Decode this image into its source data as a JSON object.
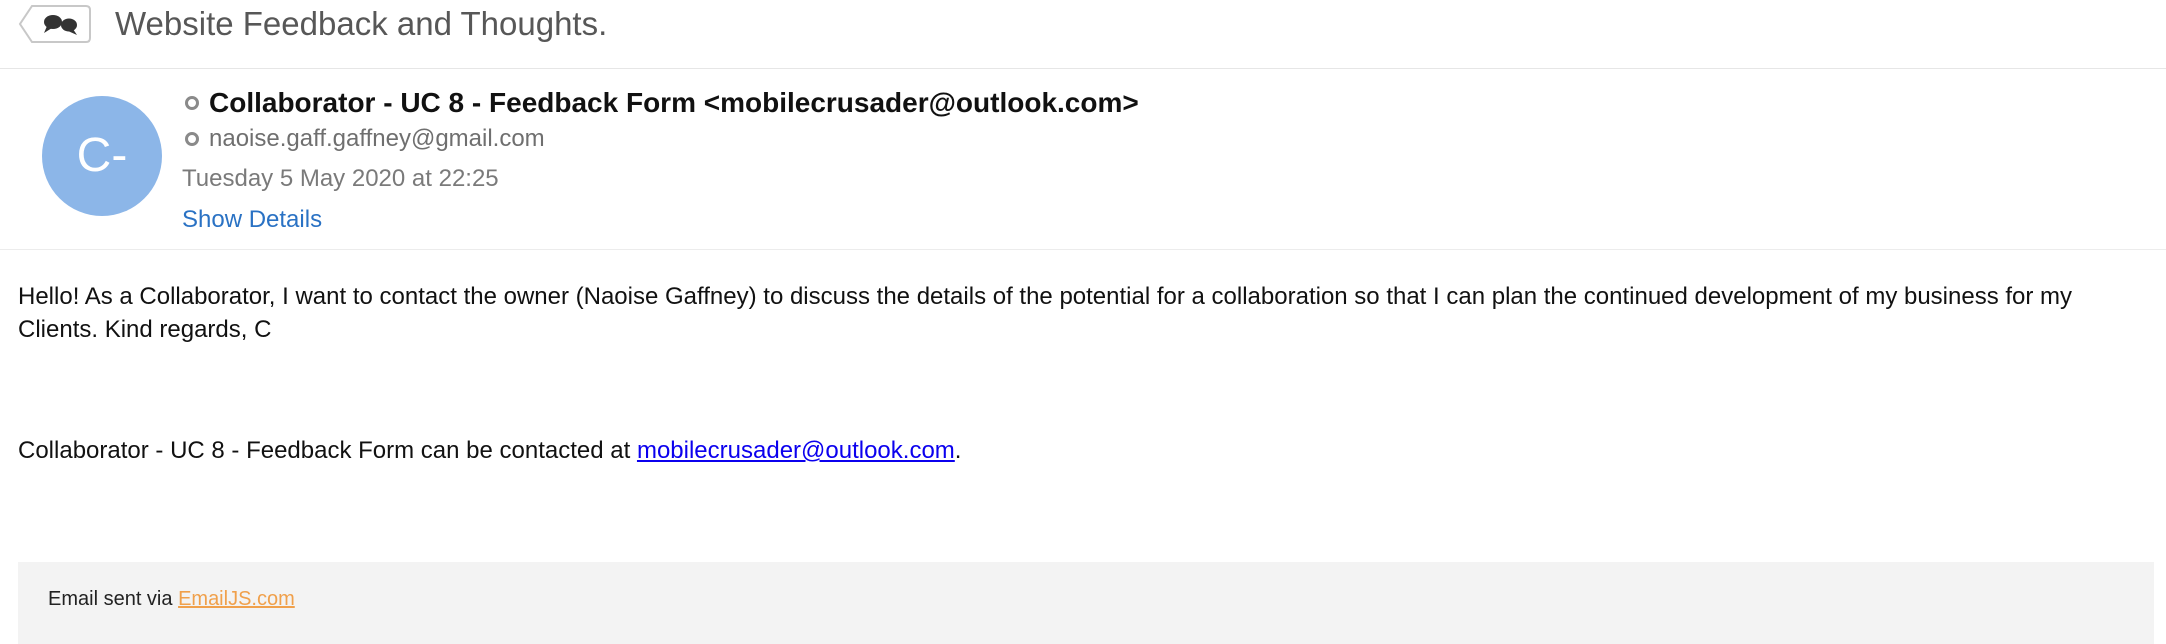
{
  "thread": {
    "subject": "Website Feedback and Thoughts.",
    "back_icon": "speech-bubbles-icon"
  },
  "message": {
    "avatar_initials": "C-",
    "avatar_color": "#8cb6e8",
    "sender": "Collaborator - UC 8 - Feedback Form <mobilecrusader@outlook.com>",
    "recipient": "naoise.gaff.gaffney@gmail.com",
    "date": "Tuesday 5 May 2020 at 22:25",
    "show_details_label": "Show Details",
    "link_color": "#2a72c4"
  },
  "body": {
    "paragraph": "Hello! As a Collaborator, I want to contact the owner (Naoise Gaffney) to discuss the details of the potential for a collaboration so that I can plan the continued development of my business for my Clients. Kind regards, C",
    "contact_prefix": "Collaborator - UC 8 - Feedback Form can be contacted at ",
    "contact_email": "mobilecrusader@outlook.com",
    "contact_suffix": "."
  },
  "footer": {
    "prefix": "Email sent via ",
    "link_label": "EmailJS.com",
    "link_color": "#f0a04b"
  }
}
